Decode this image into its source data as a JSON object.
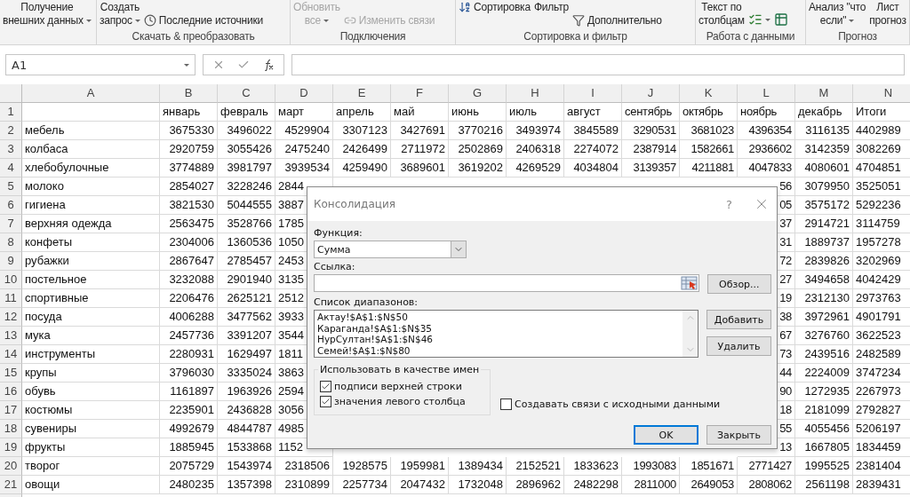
{
  "ribbon": {
    "groups": [
      {
        "items": [
          {
            "kind": "large",
            "lines": [
              "Получение",
              "внешних данных"
            ],
            "dropdown": true,
            "disabled": false
          }
        ]
      },
      {
        "label": "Скачать & преобразовать",
        "items": [
          {
            "kind": "large",
            "lines": [
              "Создать",
              "запрос"
            ],
            "dropdown": true,
            "disabled": false
          },
          {
            "kind": "small",
            "lines": [
              "Последние источники"
            ],
            "dropdown": false,
            "disabled": false
          }
        ]
      },
      {
        "label": "Подключения",
        "items": [
          {
            "kind": "large",
            "lines": [
              "Обновить",
              "все"
            ],
            "dropdown": true,
            "disabled": true
          },
          {
            "kind": "small",
            "lines": [
              "Изменить связи"
            ],
            "dropdown": false,
            "disabled": true
          }
        ]
      },
      {
        "label": "Сортировка и фильтр",
        "items": [
          {
            "kind": "top",
            "lines": [
              "Сортировка"
            ],
            "dropdown": false,
            "disabled": false
          },
          {
            "kind": "large",
            "lines": [
              "Фильтр"
            ],
            "dropdown": false,
            "disabled": false
          },
          {
            "kind": "small",
            "lines": [
              "Дополнительно"
            ],
            "dropdown": false,
            "disabled": false
          }
        ]
      },
      {
        "label": "Работа с данными",
        "items": [
          {
            "kind": "large",
            "lines": [
              "Текст по",
              "столбцам"
            ],
            "dropdown": false,
            "disabled": false
          },
          {
            "kind": "icon",
            "dropdown": true
          },
          {
            "kind": "icon",
            "dropdown": false
          }
        ]
      },
      {
        "label": "Прогноз",
        "items": [
          {
            "kind": "large",
            "lines": [
              "Анализ \"что",
              "если\""
            ],
            "dropdown": true,
            "disabled": false
          },
          {
            "kind": "large",
            "lines": [
              "Лист",
              "прогноз"
            ],
            "dropdown": false,
            "disabled": false
          }
        ]
      }
    ]
  },
  "formula_bar": {
    "name_box": "A1"
  },
  "sheet": {
    "columns": [
      "A",
      "B",
      "C",
      "D",
      "E",
      "F",
      "G",
      "H",
      "I",
      "J",
      "K",
      "L",
      "M",
      "N"
    ],
    "rows": [
      {
        "num": "1",
        "cells": [
          "",
          "январь",
          "февраль",
          "март",
          "апрель",
          "май",
          "июнь",
          "июль",
          "август",
          "сентябрь",
          "октябрь",
          "ноябрь",
          "декабрь",
          "Итоги"
        ]
      },
      {
        "num": "2",
        "cells": [
          "мебель",
          "3675330",
          "3496022",
          "4529904",
          "3307123",
          "3427691",
          "3770216",
          "3493974",
          "3845589",
          "3290531",
          "3681023",
          "4396354",
          "3116135",
          "4402989"
        ]
      },
      {
        "num": "3",
        "cells": [
          "колбаса",
          "2920759",
          "3055426",
          "2475240",
          "2426499",
          "2711972",
          "2502869",
          "2406318",
          "2274072",
          "2387914",
          "1582661",
          "2936602",
          "3142359",
          "3082269"
        ]
      },
      {
        "num": "4",
        "cells": [
          "хлебобулочные",
          "3774889",
          "3981797",
          "3939534",
          "4259490",
          "3689601",
          "3619202",
          "4269529",
          "4034804",
          "3139357",
          "4211881",
          "4047833",
          "4080601",
          "4704851"
        ]
      },
      {
        "num": "5",
        "cells": [
          "молоко",
          "2854027",
          "3228246",
          "2844",
          null,
          null,
          null,
          null,
          null,
          null,
          null,
          "56",
          "3079950",
          "3525051"
        ]
      },
      {
        "num": "6",
        "cells": [
          "гигиена",
          "3821530",
          "5044555",
          "3887",
          null,
          null,
          null,
          null,
          null,
          null,
          null,
          "05",
          "3575172",
          "5292236"
        ]
      },
      {
        "num": "7",
        "cells": [
          "верхняя одежда",
          "2563475",
          "3528766",
          "1785",
          null,
          null,
          null,
          null,
          null,
          null,
          null,
          "37",
          "2914721",
          "3114759"
        ]
      },
      {
        "num": "8",
        "cells": [
          "конфеты",
          "2304006",
          "1360536",
          "1050",
          null,
          null,
          null,
          null,
          null,
          null,
          null,
          "31",
          "1889737",
          "1957278"
        ]
      },
      {
        "num": "9",
        "cells": [
          "рубажки",
          "2867647",
          "2785457",
          "2453",
          null,
          null,
          null,
          null,
          null,
          null,
          null,
          "72",
          "2839826",
          "3202969"
        ]
      },
      {
        "num": "10",
        "cells": [
          "постельное",
          "3232088",
          "2901940",
          "3135",
          null,
          null,
          null,
          null,
          null,
          null,
          null,
          "27",
          "3494658",
          "4042429"
        ]
      },
      {
        "num": "11",
        "cells": [
          "спортивные",
          "2206476",
          "2625121",
          "2512",
          null,
          null,
          null,
          null,
          null,
          null,
          null,
          "19",
          "2312130",
          "2973763"
        ]
      },
      {
        "num": "12",
        "cells": [
          "посуда",
          "4006288",
          "3477562",
          "3933",
          null,
          null,
          null,
          null,
          null,
          null,
          null,
          "38",
          "3972961",
          "4901791"
        ]
      },
      {
        "num": "13",
        "cells": [
          "мука",
          "2457736",
          "3391207",
          "3544",
          null,
          null,
          null,
          null,
          null,
          null,
          null,
          "67",
          "3276760",
          "3622523"
        ]
      },
      {
        "num": "14",
        "cells": [
          "инструменты",
          "2280931",
          "1629497",
          "1811",
          null,
          null,
          null,
          null,
          null,
          null,
          null,
          "73",
          "2439516",
          "2482589"
        ]
      },
      {
        "num": "15",
        "cells": [
          "крупы",
          "3796030",
          "3335024",
          "3863",
          null,
          null,
          null,
          null,
          null,
          null,
          null,
          "44",
          "2224009",
          "3747234"
        ]
      },
      {
        "num": "16",
        "cells": [
          "обувь",
          "1161897",
          "1963926",
          "2594",
          null,
          null,
          null,
          null,
          null,
          null,
          null,
          "90",
          "1272935",
          "2267973"
        ]
      },
      {
        "num": "17",
        "cells": [
          "костюмы",
          "2235901",
          "2436828",
          "3056",
          null,
          null,
          null,
          null,
          null,
          null,
          null,
          "18",
          "2181099",
          "2792827"
        ]
      },
      {
        "num": "18",
        "cells": [
          "сувениры",
          "4992679",
          "4844787",
          "4985",
          null,
          null,
          null,
          null,
          null,
          null,
          null,
          "55",
          "4055456",
          "5206197"
        ]
      },
      {
        "num": "19",
        "cells": [
          "фрукты",
          "1885945",
          "1533868",
          "1152",
          null,
          null,
          null,
          null,
          null,
          null,
          null,
          "13",
          "1667805",
          "1834459"
        ]
      },
      {
        "num": "20",
        "cells": [
          "творог",
          "2075729",
          "1543974",
          "2318506",
          "1928575",
          "1959981",
          "1389434",
          "2152521",
          "1833623",
          "1993083",
          "1851671",
          "2771427",
          "1995525",
          "2381404"
        ]
      },
      {
        "num": "21",
        "cells": [
          "овощи",
          "2480235",
          "1357398",
          "2310899",
          "2257734",
          "2047432",
          "1732048",
          "2896962",
          "2482298",
          "2811000",
          "2649053",
          "2808062",
          "2561198",
          "2839431"
        ]
      }
    ]
  },
  "dialog": {
    "title": "Консолидация",
    "help": "?",
    "function_label": "Функция:",
    "function_value": "Сумма",
    "reference_label": "Ссылка:",
    "browse_button": "Обзор...",
    "ranges_label": "Список диапазонов:",
    "ranges": [
      "Актау!$A$1:$N$50",
      "Караганда!$A$1:$N$35",
      "НурСултан!$A$1:$N$46",
      "Семей!$A$1:$N$80"
    ],
    "add_button": "Добавить",
    "delete_button": "Удалить",
    "names_group": "Использовать в качестве имен",
    "options": [
      {
        "label": "подписи верхней строки",
        "checked": true
      },
      {
        "label": "значения левого столбца",
        "checked": true
      }
    ],
    "links_option": {
      "label": "Создавать связи с исходными данными",
      "checked": false
    },
    "ok_button": "OK",
    "close_button": "Закрыть"
  }
}
